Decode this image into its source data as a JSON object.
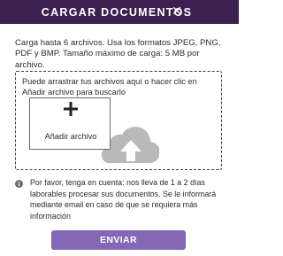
{
  "header": {
    "title": "CARGAR DOCUMENTOS",
    "close_icon": "close-icon",
    "background_color": "#3c2150"
  },
  "intro_text": "Carga hasta 6 archivos. Usa los formatos JPEG, PNG, PDF y BMP. Tamaño máximo de carga: 5 MB por archivo.",
  "dropzone": {
    "instructions": "Puede arrastrar tus archivos aquí o hacer clic en Añadir archivo para buscarlo",
    "add_button_label": "Añadir archivo",
    "add_icon": "plus-icon",
    "background_icon": "cloud-upload-icon",
    "cloud_color": "#b9b9b9"
  },
  "notice": {
    "icon": "info-icon",
    "text": "Por favor, tenga en cuenta: nos lleva de 1 a 2 días laborables procesar sus documentos. Se le informará mediante email en caso de que se requiera más información"
  },
  "submit_button": {
    "label": "ENVIAR",
    "color": "#8468b6"
  }
}
